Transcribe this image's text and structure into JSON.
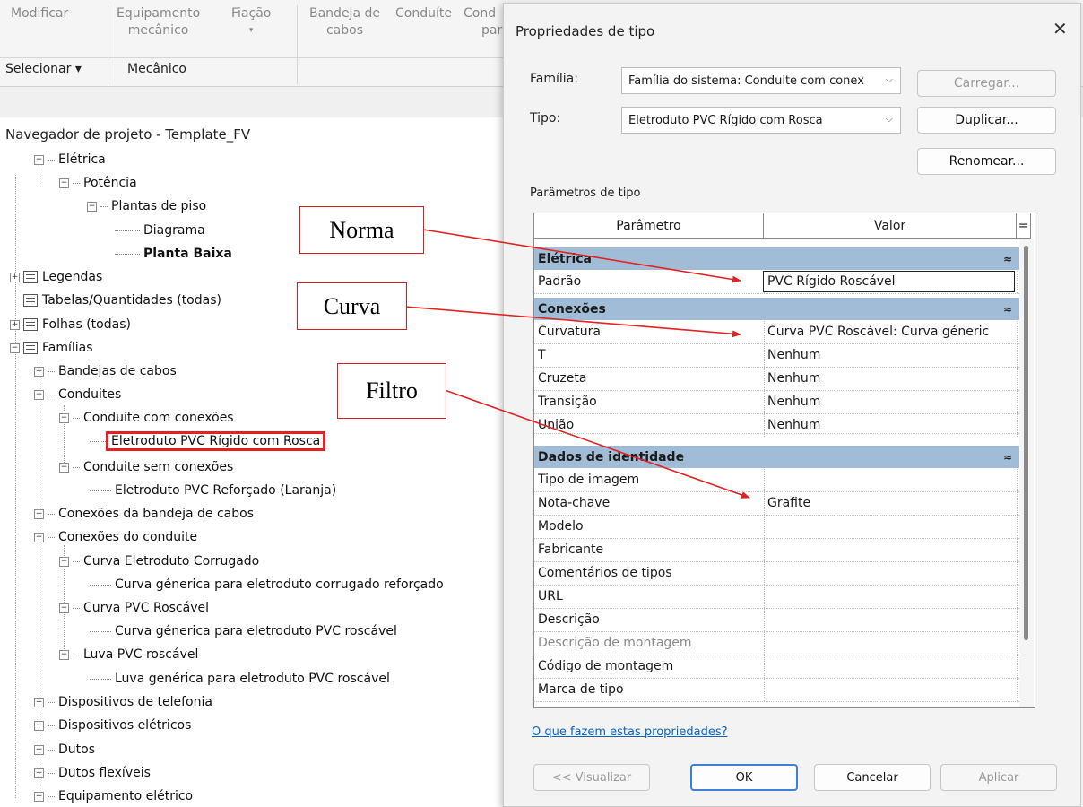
{
  "ribbon": {
    "modify": "Modificar",
    "mech_equipment": [
      "Equipamento",
      "mecânico"
    ],
    "wiring": "Fiação",
    "cable_tray": [
      "Bandeja de",
      "cabos"
    ],
    "conduit": "Conduíte",
    "cond_partial": [
      "Cond",
      "para"
    ],
    "select_panel": "Selecionar ▾",
    "mech_panel": "Mecânico"
  },
  "navigator": {
    "title": "Navegador de projeto - Template_FV",
    "nodes": {
      "eletrica": "Elétrica",
      "potencia": "Potência",
      "plantas": "Plantas de piso",
      "diagrama": "Diagrama",
      "planta_baixa": "Planta Baixa",
      "legendas": "Legendas",
      "tabelas": "Tabelas/Quantidades (todas)",
      "folhas": "Folhas (todas)",
      "familias": "Famílias",
      "bandejas": "Bandejas de cabos",
      "conduites": "Conduites",
      "cond_com": "Conduite com conexões",
      "eletroduto_rosca": "Eletroduto PVC Rígido com Rosca",
      "cond_sem": "Conduite sem conexões",
      "eletroduto_laranja": "Eletroduto PVC Reforçado (Laranja)",
      "con_bandeja": "Conexões da bandeja de cabos",
      "con_conduite": "Conexões do conduite",
      "curva_corrugado": "Curva Eletroduto Corrugado",
      "curva_gen_corrugado": "Curva génerica para eletroduto corrugado reforçado",
      "curva_pvc": "Curva PVC Roscável",
      "curva_gen_pvc": "Curva génerica para eletroduto PVC roscável",
      "luva_pvc": "Luva PVC roscável",
      "luva_gen": "Luva genérica para eletroduto PVC roscável",
      "disp_telefonia": "Dispositivos de telefonia",
      "disp_eletricos": "Dispositivos elétricos",
      "dutos": "Dutos",
      "dutos_flex": "Dutos flexíveis",
      "equip_eletrico": "Equipamento elétrico"
    }
  },
  "dialog": {
    "title": "Propriedades de tipo",
    "close_glyph": "✕",
    "family_label": "Família:",
    "family_value": "Família do sistema: Conduite com conex",
    "type_label": "Tipo:",
    "type_value": "Eletroduto PVC Rígido com Rosca",
    "load_button": "Carregar...",
    "duplicate_button": "Duplicar...",
    "rename_button": "Renomear...",
    "params_label": "Parâmetros de tipo",
    "col_param": "Parâmetro",
    "col_value": "Valor",
    "col_eq": "=",
    "sections": {
      "eletrica": "Elétrica",
      "conexoes": "Conexões",
      "identidade": "Dados de identidade"
    },
    "rows": {
      "padrao": {
        "p": "Padrão",
        "v": "PVC Rígido Roscável"
      },
      "curvatura": {
        "p": "Curvatura",
        "v": "Curva PVC Roscável: Curva géneric"
      },
      "t": {
        "p": "T",
        "v": "Nenhum"
      },
      "cruzeta": {
        "p": "Cruzeta",
        "v": "Nenhum"
      },
      "transicao": {
        "p": "Transição",
        "v": "Nenhum"
      },
      "uniao": {
        "p": "União",
        "v": "Nenhum"
      },
      "tipo_imagem": {
        "p": "Tipo de imagem",
        "v": ""
      },
      "nota_chave": {
        "p": "Nota-chave",
        "v": "Grafite"
      },
      "modelo": {
        "p": "Modelo",
        "v": ""
      },
      "fabricante": {
        "p": "Fabricante",
        "v": ""
      },
      "comentarios": {
        "p": "Comentários de tipos",
        "v": ""
      },
      "url": {
        "p": "URL",
        "v": ""
      },
      "descricao": {
        "p": "Descrição",
        "v": ""
      },
      "desc_montagem": {
        "p": "Descrição de montagem",
        "v": ""
      },
      "cod_montagem": {
        "p": "Código de montagem",
        "v": ""
      },
      "marca_tipo": {
        "p": "Marca de tipo",
        "v": ""
      }
    },
    "help_link": "O que fazem estas propriedades?",
    "preview_button": "<< Visualizar",
    "ok_button": "OK",
    "cancel_button": "Cancelar",
    "apply_button": "Aplicar"
  },
  "annotations": {
    "norma": "Norma",
    "curva": "Curva",
    "filtro": "Filtro"
  },
  "colors": {
    "section_header": "#a0bcd7",
    "annotation_red": "#e32222",
    "link_blue": "#0a63c9"
  }
}
